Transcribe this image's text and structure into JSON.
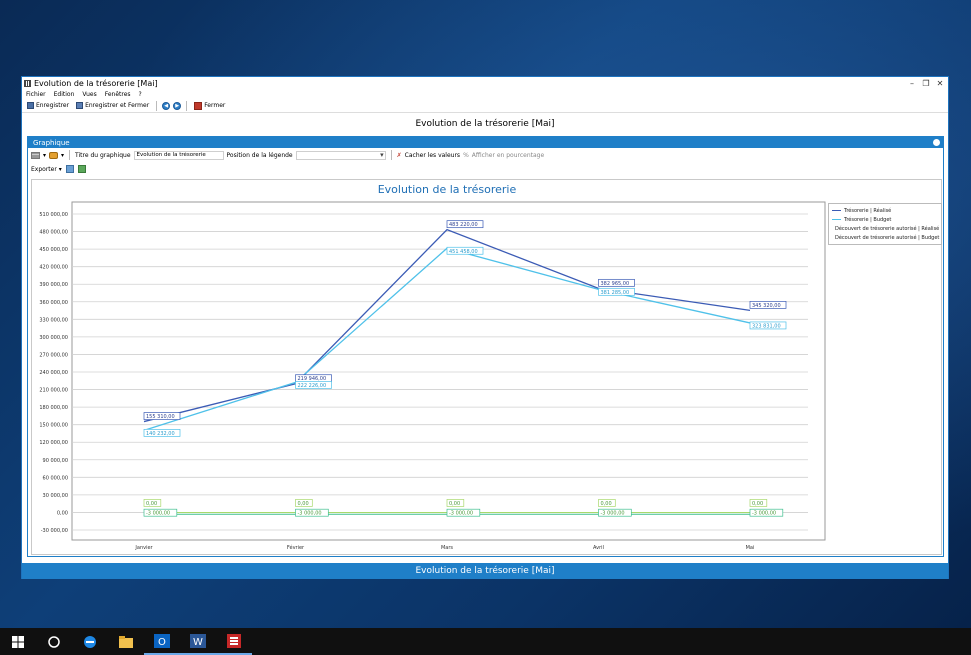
{
  "window": {
    "title": "Evolution de la trésorerie [Mai]",
    "controls": [
      "–",
      "❐",
      "✕"
    ]
  },
  "menu": [
    "Fichier",
    "Edition",
    "Vues",
    "Fenêtres",
    "?"
  ],
  "toolbar": {
    "save_label": "Enregistrer",
    "save_close_label": "Enregistrer et Fermer",
    "close_label": "Fermer"
  },
  "page_title": "Evolution de la trésorerie [Mai]",
  "panel": {
    "title": "Graphique",
    "chart_title_label": "Titre du graphique",
    "chart_title_value": "Evolution de la trésorerie",
    "legend_position_label": "Position de la légende",
    "legend_position_value": "",
    "hide_values_label": "Cacher les valeurs",
    "show_percent_label": "Afficher en pourcentage",
    "export_label": "Exporter"
  },
  "statusbar": "Evolution de la trésorerie [Mai]",
  "chart_data": {
    "type": "line",
    "title": "Evolution de la trésorerie",
    "categories": [
      "Janvier",
      "Février",
      "Mars",
      "Avril",
      "Mai"
    ],
    "ylim": [
      -30000,
      510000
    ],
    "yticks": [
      "510 000,00",
      "480 000,00",
      "450 000,00",
      "420 000,00",
      "390 000,00",
      "360 000,00",
      "330 000,00",
      "300 000,00",
      "270 000,00",
      "240 000,00",
      "210 000,00",
      "180 000,00",
      "150 000,00",
      "120 000,00",
      "90 000,00",
      "60 000,00",
      "30 000,00",
      "0,00",
      "-30 000,00"
    ],
    "grid": true,
    "legend": "right",
    "series": [
      {
        "name": "Trésorerie | Réalisé",
        "color": "#3b5bb5",
        "values": [
          155310,
          219946,
          483220,
          382965,
          345320
        ],
        "labels": [
          "155 310,00",
          "219 946,00",
          "483 220,00",
          "382 965,00",
          "345 320,00"
        ]
      },
      {
        "name": "Trésorerie | Budget",
        "color": "#4fc1e9",
        "values": [
          140232,
          222226,
          451458,
          381285,
          323831
        ],
        "labels": [
          "140 232,00",
          "222 226,00",
          "451 458,00",
          "381 285,00",
          "323 831,00"
        ]
      },
      {
        "name": "Découvert de trésorerie autorisé | Réalisé",
        "color": "#a8d86b",
        "values": [
          0,
          0,
          0,
          0,
          0
        ],
        "labels": [
          "0,00",
          "0,00",
          "0,00",
          "0,00",
          "0,00"
        ]
      },
      {
        "name": "Découvert de trésorerie autorisé | Budget",
        "color": "#3fbf8f",
        "values": [
          -3000,
          -3000,
          -3000,
          -3000,
          -3000
        ],
        "labels": [
          "-3 000,00",
          "-3 000,00",
          "-3 000,00",
          "-3 000,00",
          "-3 000,00"
        ]
      }
    ]
  },
  "taskbar": {
    "items": [
      "windows-icon",
      "cortana-icon",
      "edge-icon",
      "explorer-icon",
      "outlook-icon",
      "word-icon",
      "app-icon"
    ],
    "labels": {
      "outlook": "O",
      "word": "W"
    }
  }
}
